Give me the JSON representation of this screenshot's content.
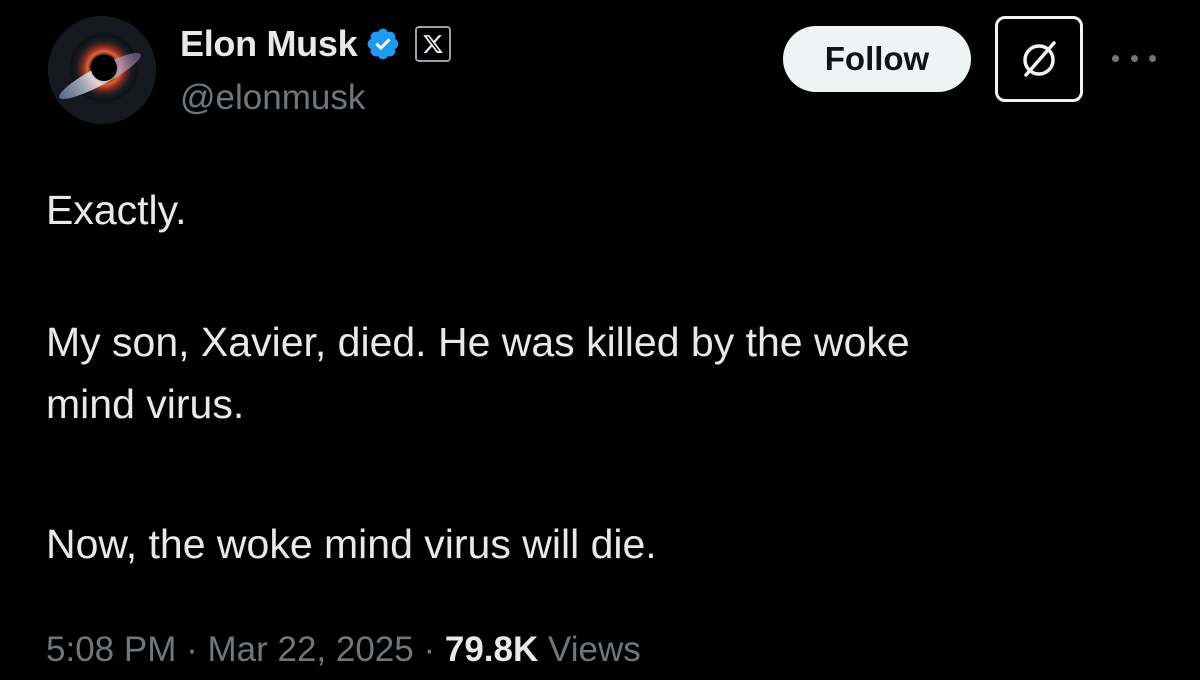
{
  "author": {
    "display_name": "Elon Musk",
    "handle": "@elonmusk",
    "verified_badge": "verified-checkmark-icon",
    "affiliation_badge": "x-logo-icon"
  },
  "actions": {
    "follow_label": "Follow",
    "grok_icon": "grok-icon",
    "more_icon": "more-options-icon"
  },
  "tweet": {
    "line1": "Exactly.",
    "line2": "My son, Xavier, died. He was killed by the woke",
    "line3": "mind virus.",
    "line4": "Now, the woke mind virus will die."
  },
  "meta": {
    "time": "5:08 PM",
    "separator": "·",
    "date": "Mar 22, 2025",
    "views_count": "79.8K",
    "views_label": "Views"
  },
  "colors": {
    "background": "#000000",
    "primary_text": "#e7e9ea",
    "secondary_text": "#71767b",
    "verified_blue": "#1d9bf0",
    "follow_bg": "#eff3f4"
  }
}
